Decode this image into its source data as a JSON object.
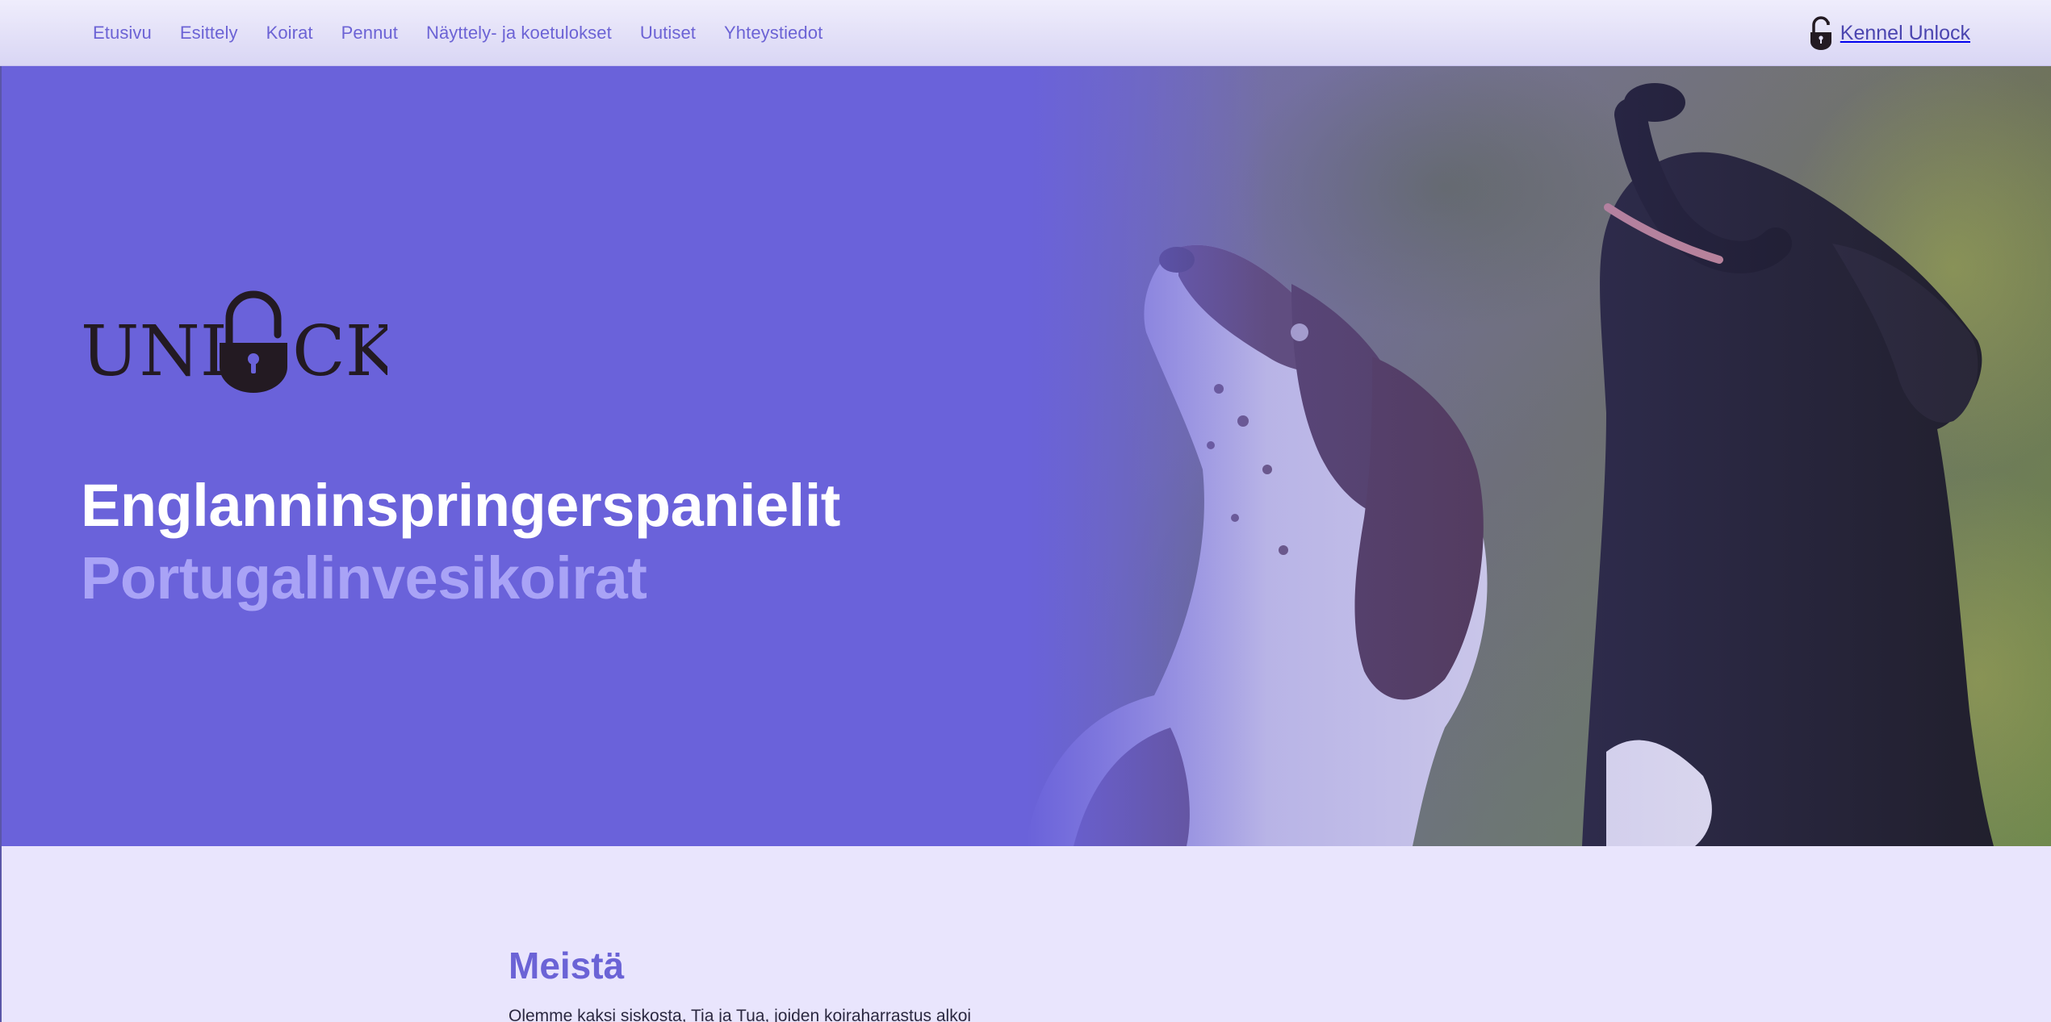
{
  "nav": {
    "items": [
      {
        "label": "Etusivu"
      },
      {
        "label": "Esittely"
      },
      {
        "label": "Koirat"
      },
      {
        "label": "Pennut"
      },
      {
        "label": "Näyttely- ja koetulokset"
      },
      {
        "label": "Uutiset"
      },
      {
        "label": "Yhteystiedot"
      }
    ],
    "brand": {
      "label": "Kennel Unlock",
      "icon": "padlock-icon"
    }
  },
  "hero": {
    "logo": {
      "text_left": "UNL",
      "text_right": "CK",
      "icon": "padlock-icon"
    },
    "title": "Englanninspringerspanielit",
    "subtitle": "Portugalinvesikoirat",
    "photo": "two-dogs-photo"
  },
  "about": {
    "title": "Meistä",
    "text": "Olemme kaksi siskosta, Tia ja Tua, joiden koiraharrastus alkoi"
  },
  "colors": {
    "accent": "#6a62da",
    "nav_text": "#6c63d5",
    "subtitle": "#a9a3f6",
    "page_bg": "#e9e5fd"
  }
}
